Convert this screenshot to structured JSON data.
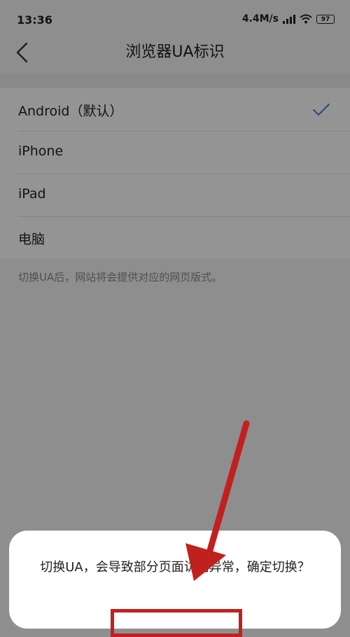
{
  "status_bar": {
    "time": "13:36",
    "speed": "4.4M/s",
    "battery": "97",
    "icons": [
      "signal-icon",
      "wifi-icon",
      "battery-icon"
    ]
  },
  "header": {
    "title": "浏览器UA标识",
    "back_icon": "chevron-left-icon"
  },
  "ua_options": [
    {
      "label": "Android（默认）",
      "selected": true
    },
    {
      "label": "iPhone",
      "selected": false
    },
    {
      "label": "iPad",
      "selected": false
    },
    {
      "label": "电脑",
      "selected": false
    }
  ],
  "hint": "切换UA后，网站将会提供对应的网页版式。",
  "dialog": {
    "message": "切换UA，会导致部分页面访问异常，确定切换？"
  },
  "colors": {
    "accent": "#3f7fe3",
    "annotation_red": "#c1211e"
  }
}
